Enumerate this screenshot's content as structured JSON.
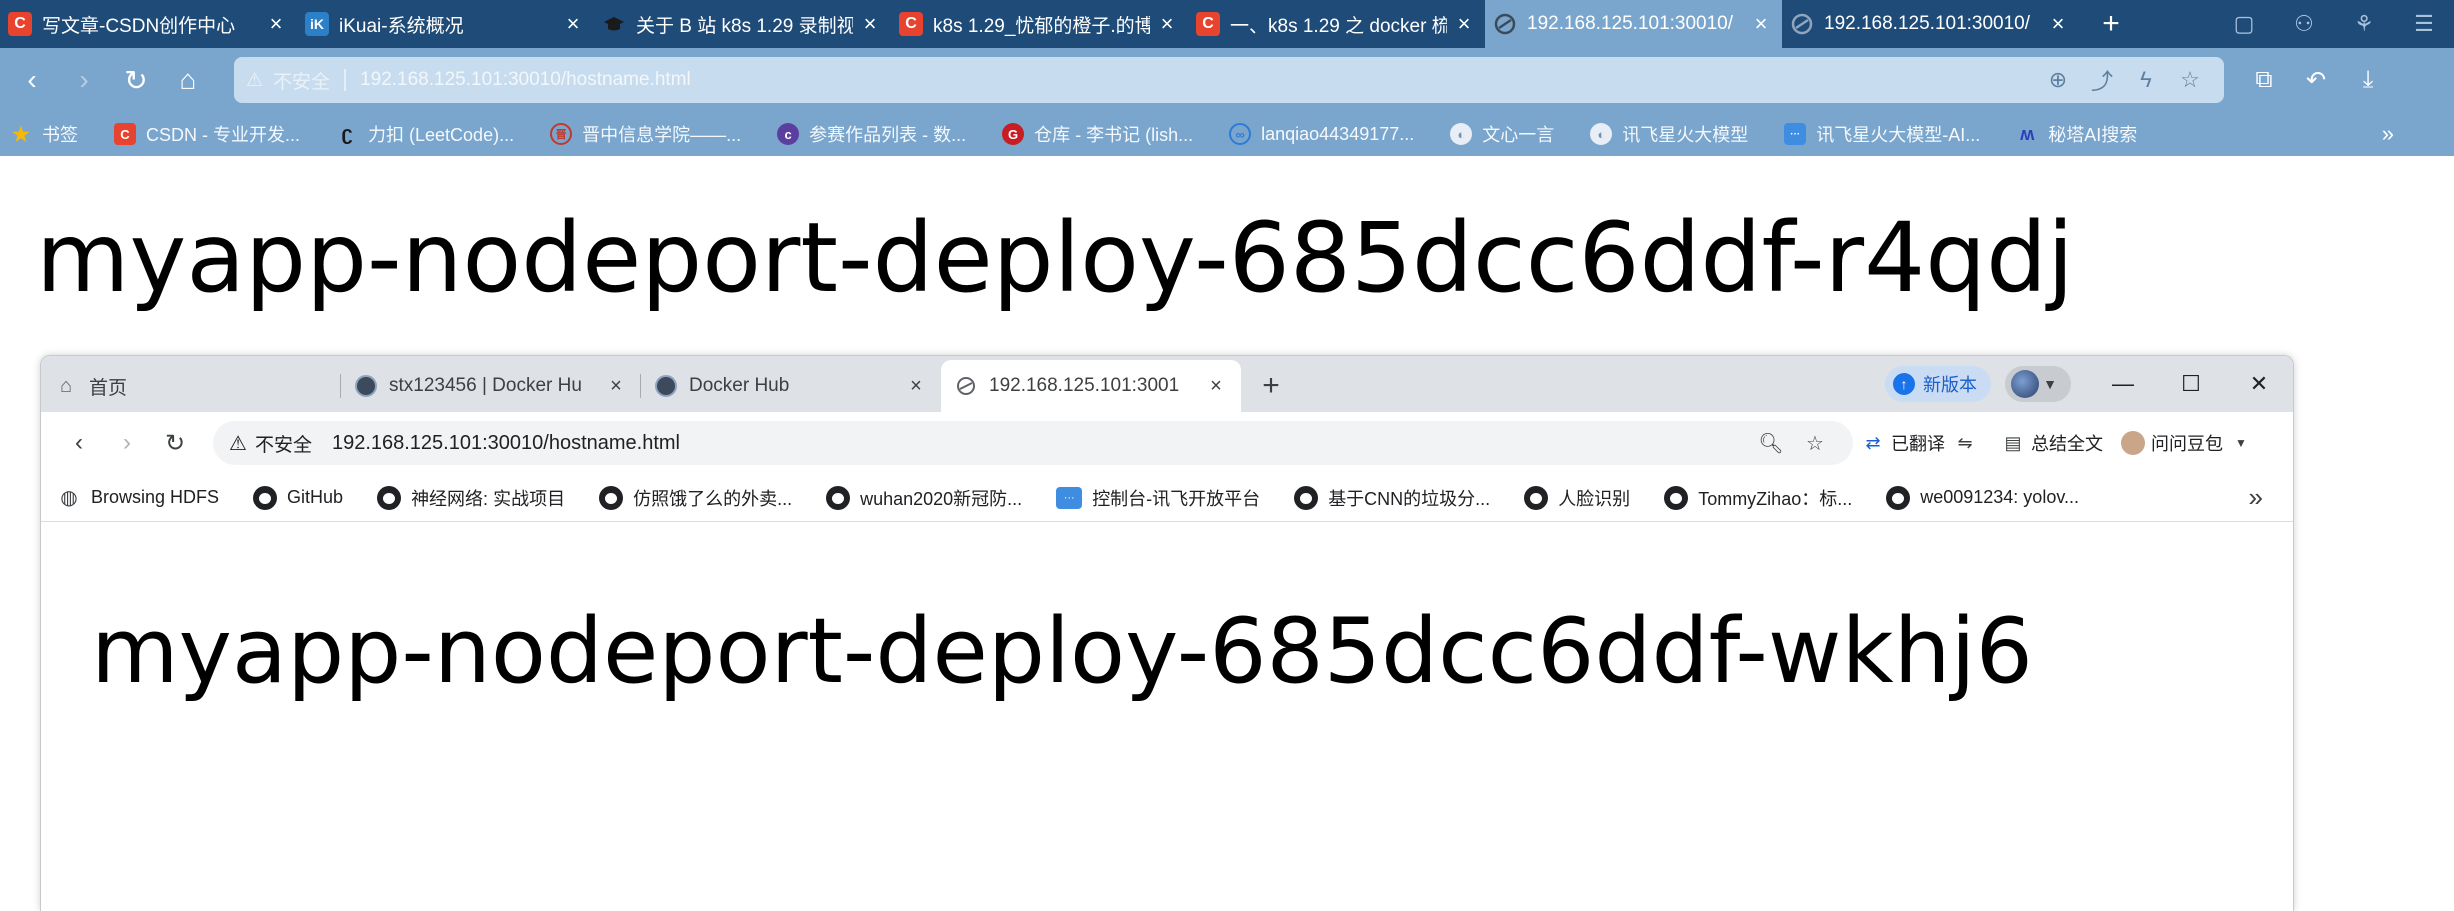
{
  "outer": {
    "tabs": [
      {
        "title": "写文章-CSDN创作中心",
        "favicon": "csdn-icon"
      },
      {
        "title": "iKuai-系统概况",
        "favicon": "ikuai-icon"
      },
      {
        "title": "关于 B 站 k8s 1.29 录制视",
        "favicon": "graduation-cap-icon"
      },
      {
        "title": "k8s 1.29_忧郁的橙子.的博",
        "favicon": "csdn-icon"
      },
      {
        "title": "一、k8s 1.29 之 docker 梳",
        "favicon": "csdn-icon"
      },
      {
        "title": "192.168.125.101:30010/",
        "favicon": "globe-icon",
        "active": true
      },
      {
        "title": "192.168.125.101:30010/",
        "favicon": "globe-icon"
      }
    ],
    "address": {
      "security_label": "不安全",
      "url": "192.168.125.101:30010/hostname.html"
    },
    "bookmarks": [
      {
        "label": "书签",
        "icon": "star-icon"
      },
      {
        "label": "CSDN - 专业开发...",
        "icon": "csdn-icon"
      },
      {
        "label": "力扣 (LeetCode)...",
        "icon": "leetcode-icon"
      },
      {
        "label": "晋中信息学院——...",
        "icon": "school-icon"
      },
      {
        "label": "参赛作品列表 - 数...",
        "icon": "contest-icon"
      },
      {
        "label": "仓库 - 李书记 (lish...",
        "icon": "gitee-icon"
      },
      {
        "label": "lanqiao44349177...",
        "icon": "lanqiao-icon"
      },
      {
        "label": "文心一言",
        "icon": "ernie-icon"
      },
      {
        "label": "讯飞星火大模型",
        "icon": "ernie-icon"
      },
      {
        "label": "讯飞星火大模型-AI...",
        "icon": "xunfei-icon"
      },
      {
        "label": "秘塔AI搜索",
        "icon": "metaso-icon"
      }
    ],
    "more_label": "»",
    "heading": "myapp-nodeport-deploy-685dcc6ddf-r4qdj"
  },
  "inner": {
    "tabs": [
      {
        "title": "首页",
        "favicon": "home-icon"
      },
      {
        "title": "stx123456 | Docker Hu",
        "favicon": "docker-icon"
      },
      {
        "title": "Docker Hub",
        "favicon": "docker-icon"
      },
      {
        "title": "192.168.125.101:3001",
        "favicon": "globe-icon",
        "active": true
      }
    ],
    "new_version_label": "新版本",
    "address": {
      "security_label": "不安全",
      "url": "192.168.125.101:30010/hostname.html"
    },
    "extensions": {
      "translate_label": "已翻译",
      "summary_label": "总结全文",
      "doubao_label": "问问豆包"
    },
    "bookmarks": [
      {
        "label": "Browsing HDFS",
        "icon": "globe-icon"
      },
      {
        "label": "GitHub",
        "icon": "github-icon"
      },
      {
        "label": "神经网络: 实战项目",
        "icon": "github-icon"
      },
      {
        "label": "仿照饿了么的外卖...",
        "icon": "github-icon"
      },
      {
        "label": "wuhan2020新冠防...",
        "icon": "github-icon"
      },
      {
        "label": "控制台-讯飞开放平台",
        "icon": "xunfei-icon"
      },
      {
        "label": "基于CNN的垃圾分...",
        "icon": "github-icon"
      },
      {
        "label": "人脸识别",
        "icon": "github-icon"
      },
      {
        "label": "TommyZihao：标...",
        "icon": "github-icon"
      },
      {
        "label": "we0091234: yolov...",
        "icon": "github-icon"
      }
    ],
    "more_label": "»",
    "heading": "myapp-nodeport-deploy-685dcc6ddf-wkhj6"
  }
}
